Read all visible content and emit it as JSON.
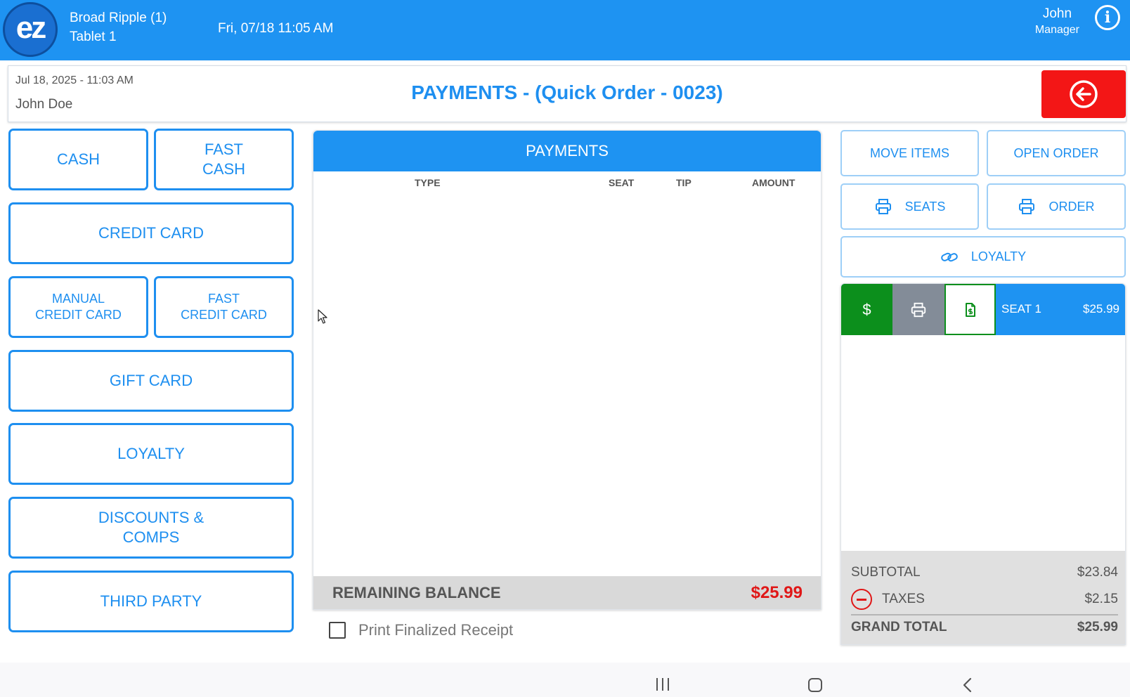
{
  "topbar": {
    "logo_text": "ez",
    "location": "Broad Ripple (1)",
    "device": "Tablet 1",
    "datetime": "Fri, 07/18 11:05 AM",
    "user_name": "John",
    "user_role": "Manager",
    "info_glyph": "i"
  },
  "order": {
    "timestamp": "Jul 18, 2025  - 11:03 AM",
    "customer": "John Doe",
    "title": "PAYMENTS - (Quick Order - 0023)"
  },
  "payment_methods": [
    "CASH",
    "FAST\nCASH",
    "CREDIT CARD",
    "MANUAL\nCREDIT CARD",
    "FAST\nCREDIT CARD",
    "GIFT CARD",
    "LOYALTY",
    "DISCOUNTS &\nCOMPS",
    "THIRD PARTY"
  ],
  "payments": {
    "header": "PAYMENTS",
    "columns": [
      "TYPE",
      "SEAT",
      "TIP",
      "AMOUNT"
    ],
    "rows": [],
    "remaining_label": "REMAINING BALANCE",
    "remaining_value": "$25.99",
    "print_receipt_label": "Print Finalized Receipt",
    "print_receipt_checked": false
  },
  "actions": {
    "move_items": "MOVE ITEMS",
    "open_order": "OPEN ORDER",
    "print_seats": "SEATS",
    "print_order": "ORDER",
    "loyalty": "LOYALTY"
  },
  "seats": [
    {
      "label": "SEAT 1",
      "amount": "$25.99",
      "pay_glyph": "$"
    }
  ],
  "totals": {
    "subtotal_label": "SUBTOTAL",
    "subtotal_value": "$23.84",
    "taxes_label": "TAXES",
    "taxes_value": "$2.15",
    "grand_label": "GRAND TOTAL",
    "grand_value": "$25.99"
  },
  "colors": {
    "primary": "#1e93f2",
    "danger": "#f31616",
    "success": "#0c8f1c",
    "neutral": "#838c98"
  },
  "icons": [
    "info-icon",
    "back-arrow-icon",
    "printer-icon",
    "link-icon",
    "dollar-icon",
    "receipt-icon",
    "minus-circle-icon"
  ]
}
